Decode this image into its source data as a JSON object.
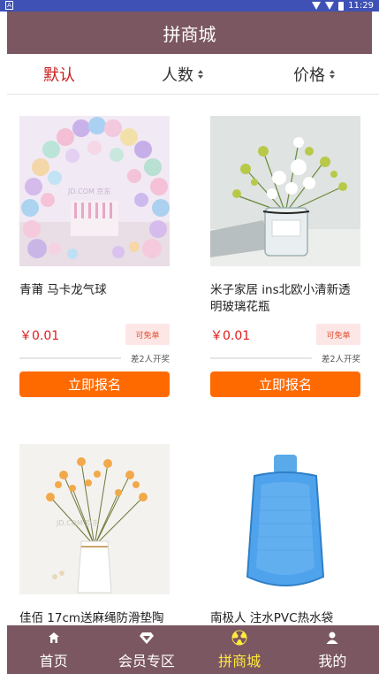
{
  "status_bar": {
    "time": "11:29",
    "left_icon": "A"
  },
  "header": {
    "title": "拼商城"
  },
  "sort": {
    "default_label": "默认",
    "people_label": "人数",
    "price_label": "价格"
  },
  "products": [
    {
      "name": "青莆 马卡龙气球",
      "price": "￥0.01",
      "tag": "可免单",
      "remain": "差2人开奖",
      "button": "立即报名",
      "image": "balloon-arch-image",
      "progress": 0
    },
    {
      "name": "米子家居 ins北欧小清新透明玻璃花瓶",
      "price": "￥0.01",
      "tag": "可免单",
      "remain": "差2人开奖",
      "button": "立即报名",
      "image": "glass-vase-flowers-image",
      "progress": 0
    },
    {
      "name": "佳佰 17cm送麻绳防滑垫陶",
      "image": "ceramic-vase-flowers-image"
    },
    {
      "name": "南极人 注水PVC热水袋",
      "image": "hot-water-bag-image"
    }
  ],
  "tabbar": {
    "items": [
      {
        "label": "首页",
        "icon": "home-icon"
      },
      {
        "label": "会员专区",
        "icon": "diamond-icon"
      },
      {
        "label": "拼商城",
        "icon": "radiation-icon",
        "active": true
      },
      {
        "label": "我的",
        "icon": "user-icon"
      }
    ]
  },
  "colors": {
    "header_bg": "#7b5761",
    "accent_orange": "#ff6a00",
    "active_sort": "#c81b1b",
    "active_tab": "#ffea3d",
    "price_red": "#e21a1a"
  }
}
